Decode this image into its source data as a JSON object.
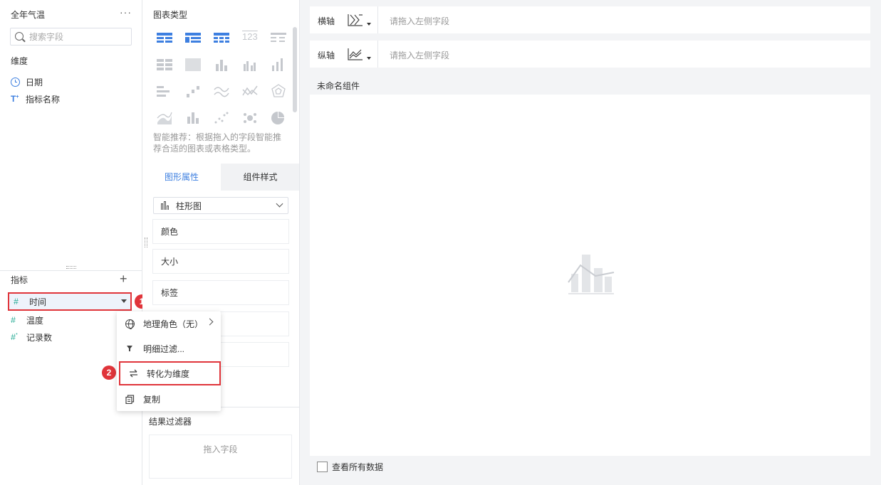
{
  "left_panel": {
    "dataset_title": "全年气温",
    "more": "···",
    "search_placeholder": "搜索字段",
    "dimensions_label": "维度",
    "dimensions": [
      {
        "label": "日期",
        "icon": "clock-icon"
      },
      {
        "label": "指标名称",
        "icon": "text-type-icon"
      }
    ],
    "metrics_label": "指标",
    "add": "+",
    "metrics": [
      {
        "label": "时间",
        "icon": "hash-icon"
      },
      {
        "label": "温度",
        "icon": "hash-icon"
      },
      {
        "label": "记录数",
        "icon": "hash-star-icon"
      }
    ]
  },
  "annotations": {
    "step1": "1",
    "step2": "2",
    "accent_color": "#e0343a"
  },
  "context_menu": {
    "items": [
      {
        "label": "地理角色（无）",
        "icon": "globe-icon"
      },
      {
        "label": "明细过滤...",
        "icon": "filter-icon"
      },
      {
        "label": "转化为维度",
        "icon": "swap-icon"
      },
      {
        "label": "复制",
        "icon": "copy-icon"
      }
    ]
  },
  "middle_panel": {
    "chart_type_title": "图表类型",
    "smart_hint": "智能推荐：根据拖入的字段智能推荐合适的图表或表格类型。",
    "tabs": [
      {
        "label": "图形属性",
        "active": true
      },
      {
        "label": "组件样式",
        "active": false
      }
    ],
    "chart_select": "柱形图",
    "properties": [
      "颜色",
      "大小",
      "标签"
    ],
    "filter_title": "结果过滤器",
    "filter_drop": "拖入字段",
    "accent_color": "#3d7fe0"
  },
  "canvas": {
    "x_axis_label": "横轴",
    "y_axis_label": "纵轴",
    "axis_placeholder": "请拖入左侧字段",
    "component_title": "未命名组件",
    "view_all": "查看所有数据"
  }
}
